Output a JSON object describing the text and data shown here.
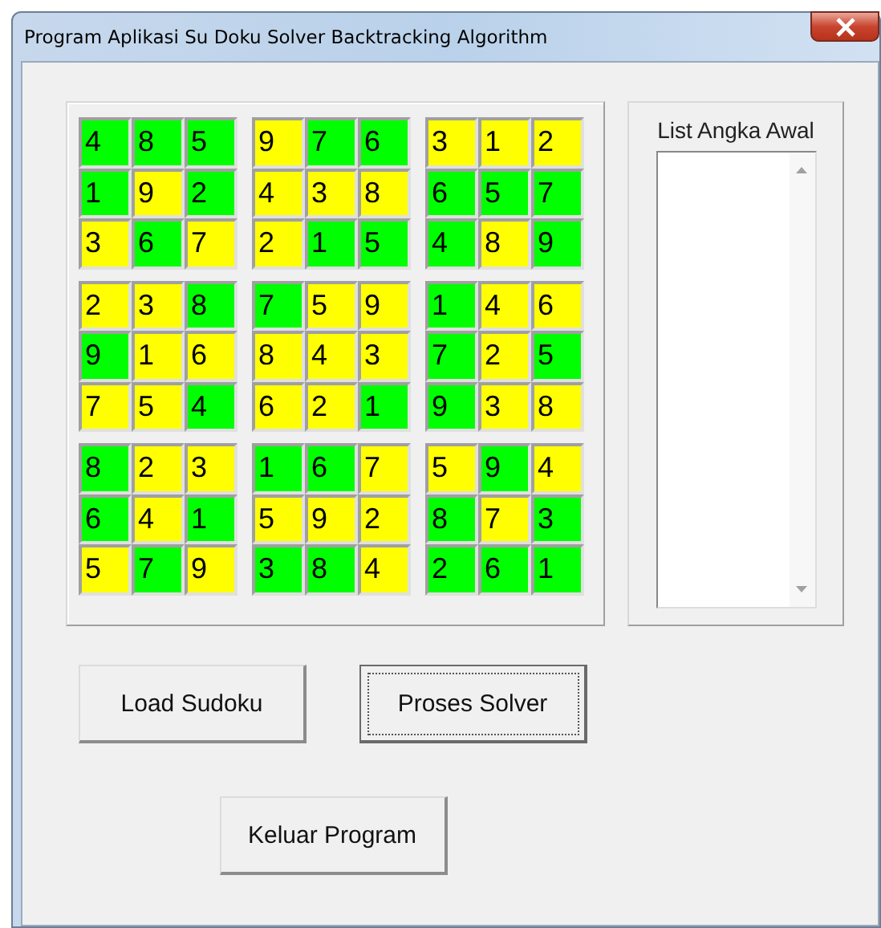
{
  "window": {
    "title": "Program Aplikasi Su Doku Solver Backtracking Algorithm"
  },
  "grid": {
    "rows": [
      [
        {
          "value": "4",
          "color": "#00ff00"
        },
        {
          "value": "8",
          "color": "#00ff00"
        },
        {
          "value": "5",
          "color": "#00ff00"
        },
        {
          "value": "9",
          "color": "#ffff00"
        },
        {
          "value": "7",
          "color": "#00ff00"
        },
        {
          "value": "6",
          "color": "#00ff00"
        },
        {
          "value": "3",
          "color": "#ffff00"
        },
        {
          "value": "1",
          "color": "#ffff00"
        },
        {
          "value": "2",
          "color": "#ffff00"
        }
      ],
      [
        {
          "value": "1",
          "color": "#00ff00"
        },
        {
          "value": "9",
          "color": "#ffff00"
        },
        {
          "value": "2",
          "color": "#00ff00"
        },
        {
          "value": "4",
          "color": "#ffff00"
        },
        {
          "value": "3",
          "color": "#ffff00"
        },
        {
          "value": "8",
          "color": "#ffff00"
        },
        {
          "value": "6",
          "color": "#00ff00"
        },
        {
          "value": "5",
          "color": "#00ff00"
        },
        {
          "value": "7",
          "color": "#00ff00"
        }
      ],
      [
        {
          "value": "3",
          "color": "#ffff00"
        },
        {
          "value": "6",
          "color": "#00ff00"
        },
        {
          "value": "7",
          "color": "#ffff00"
        },
        {
          "value": "2",
          "color": "#ffff00"
        },
        {
          "value": "1",
          "color": "#00ff00"
        },
        {
          "value": "5",
          "color": "#00ff00"
        },
        {
          "value": "4",
          "color": "#00ff00"
        },
        {
          "value": "8",
          "color": "#ffff00"
        },
        {
          "value": "9",
          "color": "#00ff00"
        }
      ],
      [
        {
          "value": "2",
          "color": "#ffff00"
        },
        {
          "value": "3",
          "color": "#ffff00"
        },
        {
          "value": "8",
          "color": "#00ff00"
        },
        {
          "value": "7",
          "color": "#00ff00"
        },
        {
          "value": "5",
          "color": "#ffff00"
        },
        {
          "value": "9",
          "color": "#ffff00"
        },
        {
          "value": "1",
          "color": "#00ff00"
        },
        {
          "value": "4",
          "color": "#ffff00"
        },
        {
          "value": "6",
          "color": "#ffff00"
        }
      ],
      [
        {
          "value": "9",
          "color": "#00ff00"
        },
        {
          "value": "1",
          "color": "#ffff00"
        },
        {
          "value": "6",
          "color": "#ffff00"
        },
        {
          "value": "8",
          "color": "#ffff00"
        },
        {
          "value": "4",
          "color": "#ffff00"
        },
        {
          "value": "3",
          "color": "#ffff00"
        },
        {
          "value": "7",
          "color": "#00ff00"
        },
        {
          "value": "2",
          "color": "#ffff00"
        },
        {
          "value": "5",
          "color": "#00ff00"
        }
      ],
      [
        {
          "value": "7",
          "color": "#ffff00"
        },
        {
          "value": "5",
          "color": "#ffff00"
        },
        {
          "value": "4",
          "color": "#00ff00"
        },
        {
          "value": "6",
          "color": "#ffff00"
        },
        {
          "value": "2",
          "color": "#ffff00"
        },
        {
          "value": "1",
          "color": "#00ff00"
        },
        {
          "value": "9",
          "color": "#00ff00"
        },
        {
          "value": "3",
          "color": "#ffff00"
        },
        {
          "value": "8",
          "color": "#ffff00"
        }
      ],
      [
        {
          "value": "8",
          "color": "#00ff00"
        },
        {
          "value": "2",
          "color": "#ffff00"
        },
        {
          "value": "3",
          "color": "#ffff00"
        },
        {
          "value": "1",
          "color": "#00ff00"
        },
        {
          "value": "6",
          "color": "#00ff00"
        },
        {
          "value": "7",
          "color": "#ffff00"
        },
        {
          "value": "5",
          "color": "#ffff00"
        },
        {
          "value": "9",
          "color": "#00ff00"
        },
        {
          "value": "4",
          "color": "#ffff00"
        }
      ],
      [
        {
          "value": "6",
          "color": "#00ff00"
        },
        {
          "value": "4",
          "color": "#ffff00"
        },
        {
          "value": "1",
          "color": "#00ff00"
        },
        {
          "value": "5",
          "color": "#ffff00"
        },
        {
          "value": "9",
          "color": "#ffff00"
        },
        {
          "value": "2",
          "color": "#ffff00"
        },
        {
          "value": "8",
          "color": "#00ff00"
        },
        {
          "value": "7",
          "color": "#ffff00"
        },
        {
          "value": "3",
          "color": "#00ff00"
        }
      ],
      [
        {
          "value": "5",
          "color": "#ffff00"
        },
        {
          "value": "7",
          "color": "#00ff00"
        },
        {
          "value": "9",
          "color": "#ffff00"
        },
        {
          "value": "3",
          "color": "#00ff00"
        },
        {
          "value": "8",
          "color": "#00ff00"
        },
        {
          "value": "4",
          "color": "#ffff00"
        },
        {
          "value": "2",
          "color": "#00ff00"
        },
        {
          "value": "6",
          "color": "#00ff00"
        },
        {
          "value": "1",
          "color": "#00ff00"
        }
      ]
    ]
  },
  "list_panel": {
    "label": "List Angka Awal"
  },
  "buttons": [
    {
      "label": "Load Sudoku",
      "focused": false
    },
    {
      "label": "Proses Solver",
      "focused": true
    },
    {
      "label": "Keluar Program",
      "focused": false
    }
  ]
}
